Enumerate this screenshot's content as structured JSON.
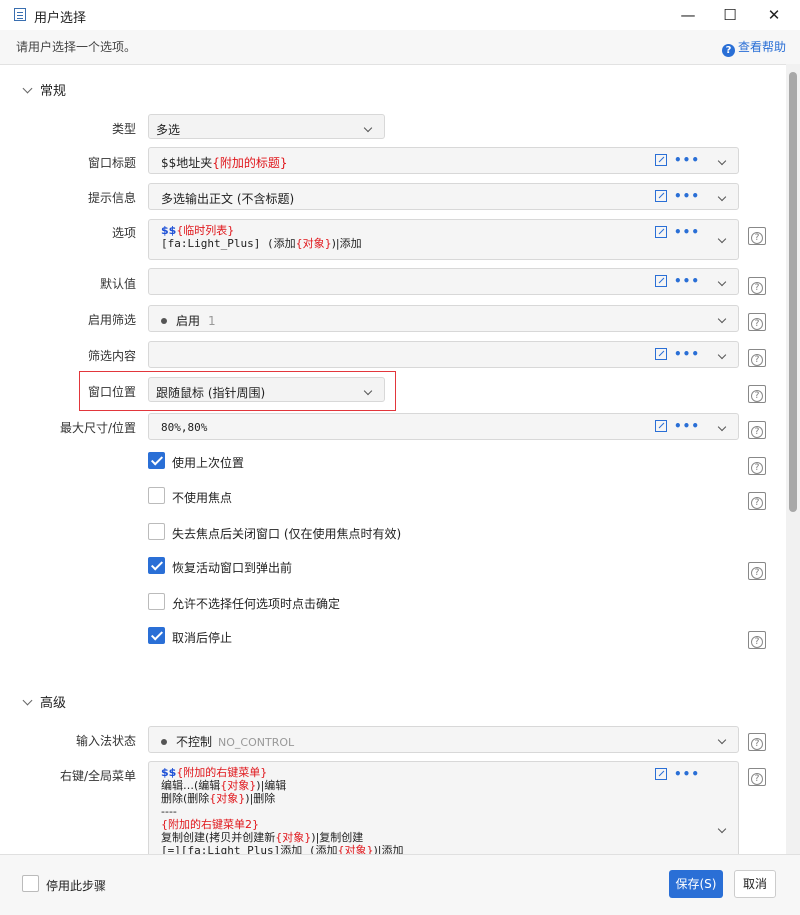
{
  "window": {
    "title": "用户选择",
    "minimize": "—",
    "maximize": "☐",
    "close": "✕"
  },
  "subheader": {
    "description": "请用户选择一个选项。",
    "help": "查看帮助",
    "help_glyph": "?"
  },
  "sections": {
    "general": "常规",
    "advanced": "高级"
  },
  "fields": {
    "type": {
      "label": "类型",
      "value": "多选"
    },
    "window_title": {
      "label": "窗口标题",
      "prefix": "$$地址夹",
      "var": "{附加的标题}"
    },
    "tip": {
      "label": "提示信息",
      "value": "多选输出正文 (不含标题)"
    },
    "options": {
      "label": "选项",
      "line1_prefix": "$$",
      "line1_var": "{临时列表}",
      "line2_a": "[fa:Light_Plus] (添加",
      "line2_var": "{对象}",
      "line2_b": ")|添加"
    },
    "default": {
      "label": "默认值",
      "value": ""
    },
    "enable_filter": {
      "label": "启用筛选",
      "value": "启用",
      "extra": "1"
    },
    "filter_content": {
      "label": "筛选内容",
      "value": ""
    },
    "window_position": {
      "label": "窗口位置",
      "value": "跟随鼠标 (指针周围)"
    },
    "max_size": {
      "label": "最大尺寸/位置",
      "value": "80%,80%"
    }
  },
  "checkboxes": [
    {
      "label": "使用上次位置",
      "checked": true
    },
    {
      "label": "不使用焦点",
      "checked": false
    },
    {
      "label": "失去焦点后关闭窗口 (仅在使用焦点时有效)",
      "checked": false
    },
    {
      "label": "恢复活动窗口到弹出前",
      "checked": true
    },
    {
      "label": "允许不选择任何选项时点击确定",
      "checked": false
    },
    {
      "label": "取消后停止",
      "checked": true
    }
  ],
  "advanced": {
    "ime": {
      "label": "输入法状态",
      "value": "不控制",
      "code": "NO_CONTROL"
    },
    "context_menu": {
      "label": "右键/全局菜单",
      "l1_prefix": "$$",
      "l1_var": "{附加的右键菜单}",
      "l2_a": "编辑…(编辑",
      "l2_var": "{对象}",
      "l2_b": ")|编辑",
      "l3_a": "删除(删除",
      "l3_var": "{对象}",
      "l3_b": ")|删除",
      "l4": "----",
      "l5_var": "{附加的右键菜单2}",
      "l6_a": "复制创建(拷贝并创建新",
      "l6_var": "{对象}",
      "l6_b": ")|复制创建",
      "l7_a": "[=][fa:Light_Plus]添加 (添加",
      "l7_var": "{对象}",
      "l7_b": ")|添加"
    }
  },
  "footer": {
    "disable_step": "停用此步骤",
    "save": "保存(S)",
    "cancel": "取消"
  },
  "icons": {
    "open": "open-external-icon",
    "more": "•••",
    "help": "?"
  }
}
